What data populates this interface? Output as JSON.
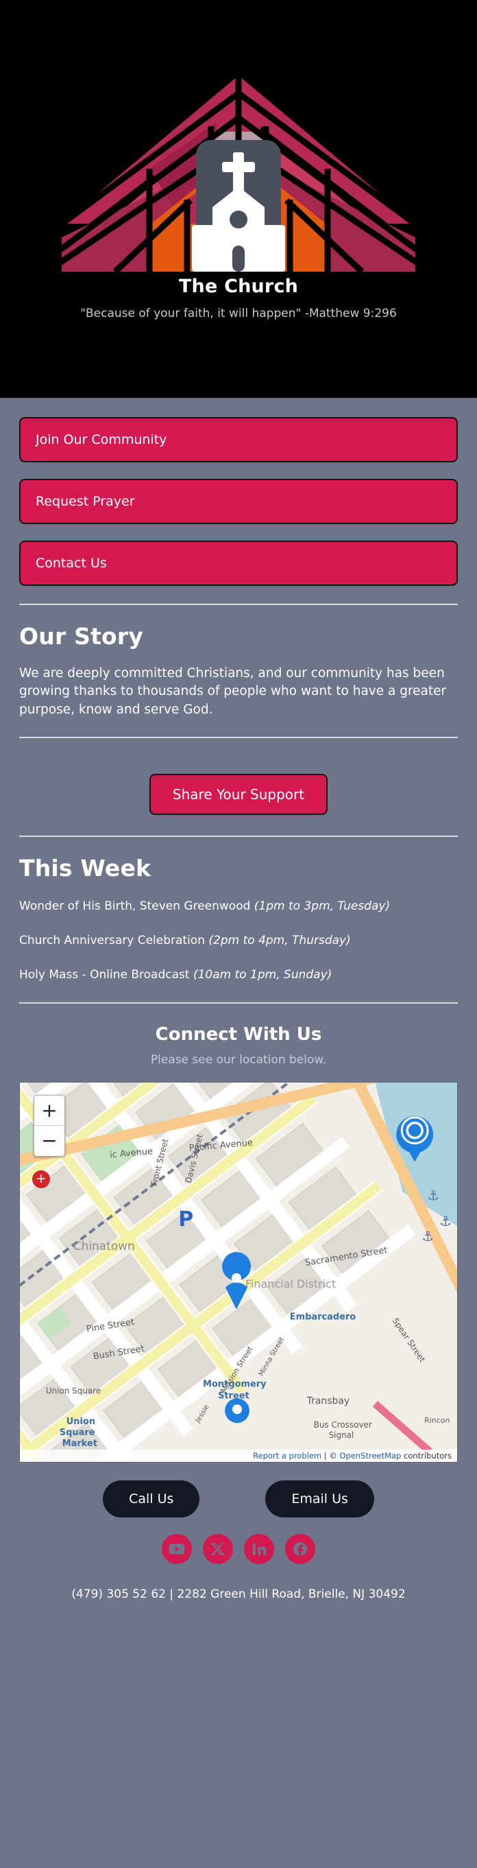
{
  "hero": {
    "title": "The Church",
    "tagline": "\"Because of your faith, it will happen\" -Matthew 9:296",
    "background_color": "#000000",
    "logo_name": "church-stained-glass-logo"
  },
  "theme": {
    "page_background": "#6e7489",
    "accent": "#d41950",
    "dark_pill": "#141824",
    "text": "#ffffff"
  },
  "cta_buttons": [
    {
      "label": "Join Our Community"
    },
    {
      "label": "Request Prayer"
    },
    {
      "label": "Contact Us"
    }
  ],
  "story": {
    "heading": "Our Story",
    "body": "We are deeply committed Christians, and our community has been growing thanks to thousands of people who want to have a greater purpose, know and serve God.",
    "support_button": "Share Your Support"
  },
  "this_week": {
    "heading": "This Week",
    "events": [
      {
        "title": "Wonder of His Birth, Steven Greenwood",
        "when": "(1pm to 3pm, Tuesday)"
      },
      {
        "title": "Church Anniversary Celebration",
        "when": "(2pm to 4pm, Thursday)"
      },
      {
        "title": "Holy Mass - Online Broadcast",
        "when": "(10am to 1pm, Sunday)"
      }
    ]
  },
  "connect": {
    "heading": "Connect With Us",
    "subtitle": "Please see our location below."
  },
  "map": {
    "zoom_in_label": "+",
    "zoom_out_label": "−",
    "attribution_report": "Report a problem",
    "attribution_separator": " | © ",
    "attribution_osm": "OpenStreetMap",
    "attribution_tail": " contributors",
    "labels": {
      "pacific_avenue": "Pacific Avenue",
      "pacific_avenue_left": "ic Avenue",
      "chinatown": "Chinatown",
      "front_street": "Front Street",
      "davis_street": "Davis Street",
      "sacramento_street": "Sacramento Street",
      "financial_district": "Financial District",
      "pine_street": "Pine Street",
      "bush_street": "Bush Street",
      "embarcadero": "Embarcadero",
      "spear_street": "Spear Street",
      "union_square": "Union Square",
      "union_square_market": "Union Square Market",
      "montgomery_street": "Montgomery Street",
      "mission_street": "Mission Street",
      "minna_street": "Minna Street",
      "transbay": "Transbay",
      "bus_crossover_signal": "Bus Crossover Signal",
      "rincon": "Rincon",
      "jessie": "Jessie"
    }
  },
  "footer": {
    "call_button": "Call Us",
    "email_button": "Email Us",
    "social": [
      {
        "name": "youtube"
      },
      {
        "name": "x-twitter"
      },
      {
        "name": "linkedin"
      },
      {
        "name": "facebook"
      }
    ],
    "address": "(479) 305 52 62 | 2282 Green Hill Road, Brielle, NJ 30492"
  }
}
